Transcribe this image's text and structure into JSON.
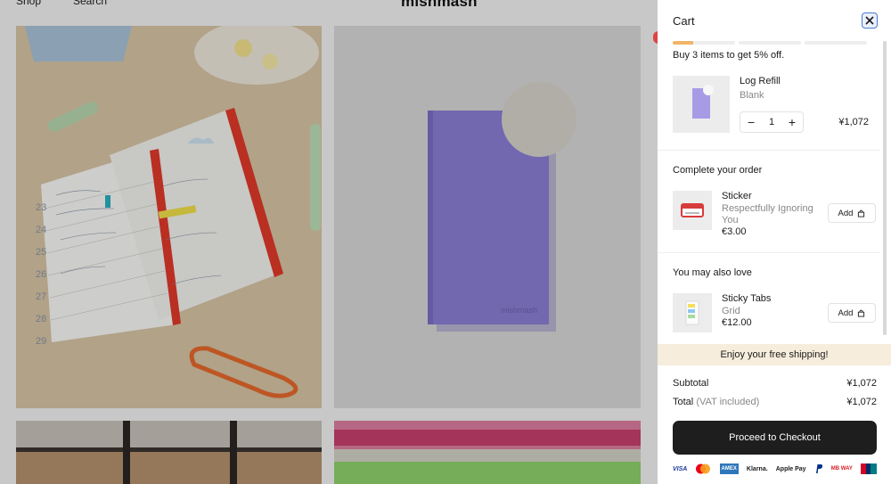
{
  "nav": {
    "shop": "Shop",
    "search": "Search",
    "brand": "mishmash"
  },
  "products": {
    "notebook_mark": "mishmash",
    "diary_numbers": [
      "23",
      "24",
      "25",
      "26",
      "27",
      "28",
      "29"
    ]
  },
  "cart": {
    "title": "Cart",
    "progress_fraction": 0.33,
    "promo": "Buy 3 items to get 5% off.",
    "item": {
      "name": "Log Refill",
      "variant": "Blank",
      "quantity": "1",
      "price": "¥1,072",
      "minus": "−",
      "plus": "+"
    },
    "complete_title": "Complete your order",
    "complete_item": {
      "name": "Sticker",
      "variant": "Respectfully Ignoring You",
      "price": "€3.00",
      "add_label": "Add"
    },
    "also_title": "You may also love",
    "also_item": {
      "name": "Sticky Tabs",
      "variant": "Grid",
      "price": "€12.00",
      "add_label": "Add"
    },
    "shipping": "Enjoy your free shipping!",
    "subtotal_label": "Subtotal",
    "subtotal": "¥1,072",
    "total_label": "Total",
    "vat_note": "(VAT included)",
    "total": "¥1,072",
    "checkout": "Proceed to Checkout",
    "payments": [
      "VISA",
      "Mastercard",
      "AMEX",
      "Klarna.",
      "Apple Pay",
      "PayPal",
      "MB WAY",
      "UnionPay"
    ]
  },
  "colors": {
    "accent": "#f2b468",
    "checkout_bg": "#1e1e1e",
    "banner": "#f7eddc",
    "notebook": "#8a7fd6"
  }
}
